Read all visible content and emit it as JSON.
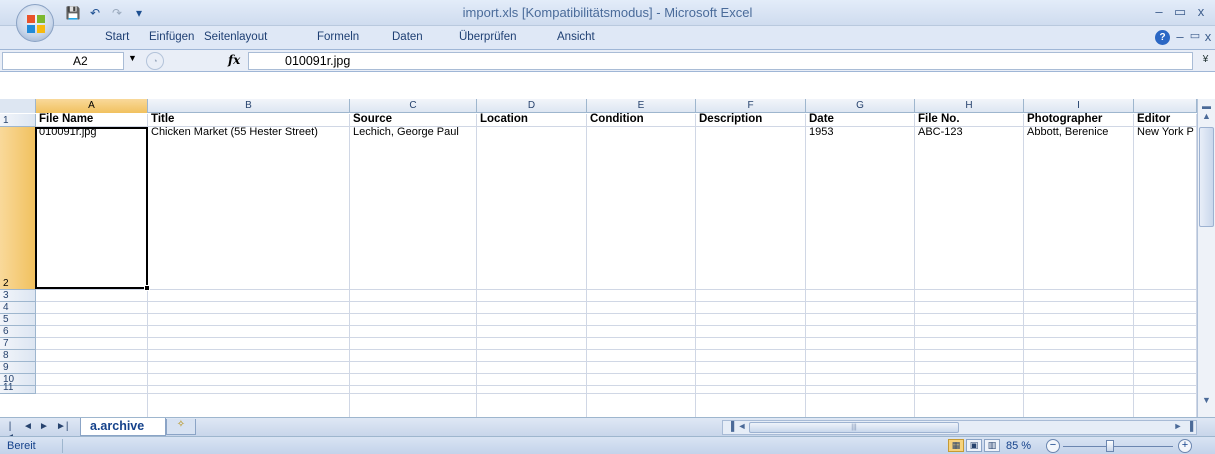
{
  "window": {
    "title": "import.xls  [Kompatibilitätsmodus] - Microsoft Excel",
    "controls": {
      "minimize": "–",
      "maximize": "▭",
      "close": "x"
    }
  },
  "quick_access": {
    "save": "💾",
    "undo": "↶",
    "redo": "↷",
    "customize": "▾"
  },
  "ribbon": {
    "tabs": [
      "Start",
      "Einfügen",
      "Seitenlayout",
      "Formeln",
      "Daten",
      "Überprüfen",
      "Ansicht"
    ],
    "help": "?",
    "doc_controls": {
      "minimize": "–",
      "restore": "▭",
      "close": "x"
    }
  },
  "formula_bar": {
    "name_box": "A2",
    "fx": "fx",
    "value": "010091r.jpg"
  },
  "sheet": {
    "columns": [
      {
        "letter": "A",
        "width": 112
      },
      {
        "letter": "B",
        "width": 202
      },
      {
        "letter": "C",
        "width": 127
      },
      {
        "letter": "D",
        "width": 110
      },
      {
        "letter": "E",
        "width": 109
      },
      {
        "letter": "F",
        "width": 110
      },
      {
        "letter": "G",
        "width": 109
      },
      {
        "letter": "H",
        "width": 109
      },
      {
        "letter": "I",
        "width": 110
      },
      {
        "letter": "",
        "width": 63
      }
    ],
    "headers": [
      "File Name",
      "Title",
      "Source",
      "Location",
      "Condition",
      "Description",
      "Date",
      "File No.",
      "Photographer",
      "Editor"
    ],
    "row2": [
      "010091r.jpg",
      "Chicken Market (55 Hester Street)",
      "Lechich, George Paul",
      "",
      "",
      "",
      "1953",
      "ABC-123",
      "Abbott, Berenice",
      "New York P"
    ],
    "row_numbers": [
      "1",
      "2",
      "3",
      "4",
      "5",
      "6",
      "7",
      "8",
      "9",
      "10",
      "11"
    ],
    "active_cell": "A2"
  },
  "sheet_tabs": {
    "nav": [
      "|◄",
      "◄",
      "►",
      "►|"
    ],
    "active": "a.archive",
    "new_sheet_icon": "✧"
  },
  "status": {
    "ready": "Bereit",
    "zoom": "85 %",
    "zoom_level": 0.85,
    "zoom_out": "−",
    "zoom_in": "+"
  }
}
